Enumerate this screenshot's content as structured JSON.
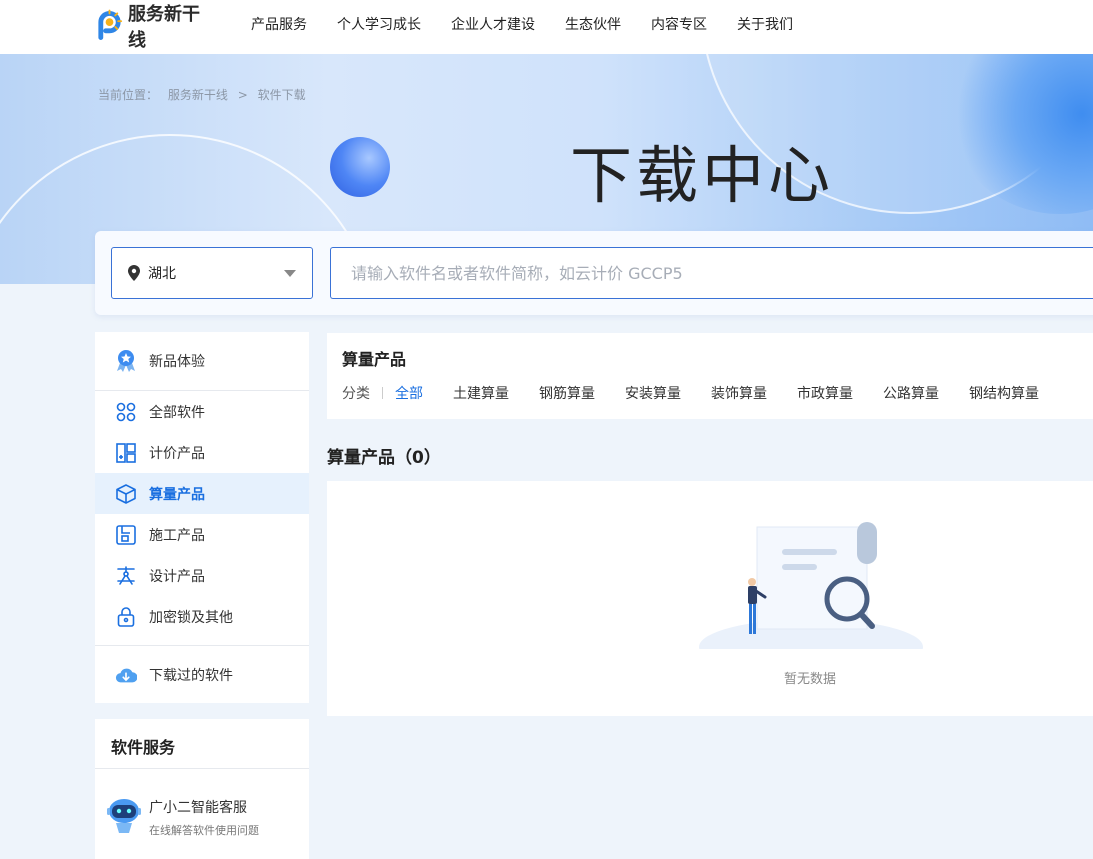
{
  "header": {
    "logo_text": "服务新干线",
    "nav": [
      "产品服务",
      "个人学习成长",
      "企业人才建设",
      "生态伙伴",
      "内容专区",
      "关于我们"
    ]
  },
  "banner": {
    "breadcrumb_prefix": "当前位置：",
    "breadcrumb_home": "服务新干线",
    "breadcrumb_sep": ">",
    "breadcrumb_current": "软件下载",
    "title": "下载中心"
  },
  "search": {
    "region": "湖北",
    "placeholder": "请输入软件名或者软件简称，如云计价 GCCP5"
  },
  "sidebar": {
    "top_item": "新品体验",
    "items": [
      "全部软件",
      "计价产品",
      "算量产品",
      "施工产品",
      "设计产品",
      "加密锁及其他"
    ],
    "active_index": 2,
    "bottom_item": "下载过的软件"
  },
  "service": {
    "title": "软件服务",
    "kefu_title": "广小二智能客服",
    "kefu_sub": "在线解答软件使用问题"
  },
  "category": {
    "title": "算量产品",
    "label": "分类",
    "items": [
      "全部",
      "土建算量",
      "钢筋算量",
      "安装算量",
      "装饰算量",
      "市政算量",
      "公路算量",
      "钢结构算量"
    ],
    "active_index": 0
  },
  "results": {
    "title": "算量产品（0）",
    "empty_text": "暂无数据"
  },
  "colors": {
    "accent": "#1a6fe0",
    "active_bg": "#e6f1fd",
    "page_bg": "#eef4fb"
  }
}
